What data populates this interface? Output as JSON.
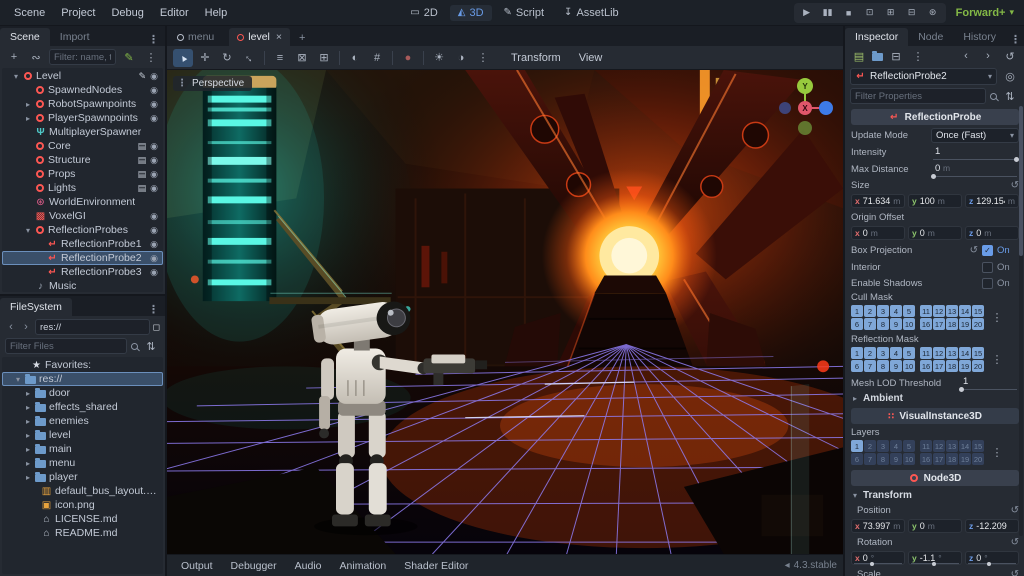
{
  "icons": {
    "play": "▶",
    "pause": "▮▮",
    "stop": "■",
    "remote_debug": "⊡",
    "play_scene": "⊞",
    "play_custom_scene": "⊟",
    "movie_maker": "⊛",
    "dropdown": "▾",
    "chevron_right": "▸",
    "close": "×",
    "add": "+",
    "instance": "∾",
    "panel_menu": "⋮",
    "script_green": "✎",
    "back": "‹",
    "forward": "›",
    "history": "↺",
    "revert": "↺",
    "check": "✓",
    "split_mode": "◻",
    "sort": "⇅",
    "new_resource": "▤",
    "save": "⊟",
    "tool": "◎",
    "dots": "⋮",
    "version": "◂"
  },
  "menubar": {
    "items": [
      "Scene",
      "Project",
      "Debug",
      "Editor",
      "Help"
    ],
    "modes": [
      {
        "label": "2D",
        "glyph": "▭",
        "cls": "mode"
      },
      {
        "label": "3D",
        "glyph": "◭",
        "cls": "mode active"
      },
      {
        "label": "Script",
        "glyph": "✎",
        "cls": "mode"
      },
      {
        "label": "AssetLib",
        "glyph": "↧",
        "cls": "mode"
      }
    ],
    "playback": [
      {
        "glyph": "▶",
        "name": "play-button"
      },
      {
        "glyph": "▮▮",
        "name": "pause-button"
      },
      {
        "glyph": "■",
        "name": "stop-button"
      },
      {
        "glyph": "⊡",
        "name": "remote-debug-button"
      },
      {
        "glyph": "⊞",
        "name": "play-scene-button"
      },
      {
        "glyph": "⊟",
        "name": "play-custom-scene-button"
      },
      {
        "glyph": "⊛",
        "name": "movie-maker-button"
      }
    ],
    "renderer": "Forward+"
  },
  "scene_dock": {
    "tabs": [
      {
        "label": "Scene",
        "cls": "ptab active"
      },
      {
        "label": "Import",
        "cls": "ptab"
      }
    ],
    "filter_placeholder": "Filter: name, t:type, g",
    "tree": [
      {
        "cls": "trow",
        "pad": 2,
        "chev": "▾",
        "icon_cls": "ic ic-ring",
        "label": "Level",
        "b1": "✎",
        "b2": "◉"
      },
      {
        "cls": "trow",
        "pad": 14,
        "chev": "",
        "icon_cls": "ic ic-ring",
        "label": "SpawnedNodes",
        "b1": "",
        "b2": "◉"
      },
      {
        "cls": "trow",
        "pad": 14,
        "chev": "▸",
        "icon_cls": "ic ic-ring",
        "label": "RobotSpawnpoints",
        "b1": "",
        "b2": "◉"
      },
      {
        "cls": "trow",
        "pad": 14,
        "chev": "▸",
        "icon_cls": "ic ic-ring",
        "label": "PlayerSpawnpoints",
        "b1": "",
        "b2": "◉"
      },
      {
        "cls": "trow",
        "pad": 14,
        "chev": "",
        "icon_cls": "ic ic-antenna",
        "glyph": "Ψ",
        "label": "MultiplayerSpawner",
        "b1": "",
        "b2": ""
      },
      {
        "cls": "trow",
        "pad": 14,
        "chev": "",
        "icon_cls": "ic ic-ring",
        "label": "Core",
        "b1": "▤",
        "b2": "◉"
      },
      {
        "cls": "trow",
        "pad": 14,
        "chev": "",
        "icon_cls": "ic ic-ring",
        "label": "Structure",
        "b1": "▤",
        "b2": "◉"
      },
      {
        "cls": "trow",
        "pad": 14,
        "chev": "",
        "icon_cls": "ic ic-ring",
        "label": "Props",
        "b1": "▤",
        "b2": "◉"
      },
      {
        "cls": "trow",
        "pad": 14,
        "chev": "",
        "icon_cls": "ic ic-ring",
        "label": "Lights",
        "b1": "▤",
        "b2": "◉"
      },
      {
        "cls": "trow",
        "pad": 14,
        "chev": "",
        "icon_cls": "ic ic-worldenv",
        "label": "WorldEnvironment",
        "b1": "",
        "b2": ""
      },
      {
        "cls": "trow",
        "pad": 14,
        "chev": "",
        "icon_cls": "ic ic-voxel",
        "label": "VoxelGI",
        "b1": "",
        "b2": "◉"
      },
      {
        "cls": "trow",
        "pad": 14,
        "chev": "▾",
        "icon_cls": "ic ic-ring",
        "label": "ReflectionProbes",
        "b1": "",
        "b2": "◉"
      },
      {
        "cls": "trow",
        "pad": 26,
        "chev": "",
        "icon_cls": "ic ic-probe",
        "label": "ReflectionProbe1",
        "b1": "",
        "b2": "◉"
      },
      {
        "cls": "trow selected",
        "pad": 26,
        "chev": "",
        "icon_cls": "ic ic-probe",
        "label": "ReflectionProbe2",
        "b1": "",
        "b2": "◉"
      },
      {
        "cls": "trow",
        "pad": 26,
        "chev": "",
        "icon_cls": "ic ic-probe",
        "label": "ReflectionProbe3",
        "b1": "",
        "b2": "◉"
      },
      {
        "cls": "trow",
        "pad": 14,
        "chev": "",
        "icon_cls": "ic ic-music",
        "label": "Music",
        "b1": "",
        "b2": ""
      }
    ]
  },
  "filesystem_dock": {
    "tab": "FileSystem",
    "path": "res://",
    "filter_placeholder": "Filter Files",
    "tree": [
      {
        "cls": "trow",
        "pad": 10,
        "chev": "",
        "icon_cls": "ic ic-star",
        "label": "Favorites:"
      },
      {
        "cls": "trow selected",
        "pad": 4,
        "chev": "▾",
        "icon_cls": "ic ic-folder",
        "label": "res://"
      },
      {
        "cls": "trow",
        "pad": 14,
        "chev": "▸",
        "icon_cls": "ic ic-folder",
        "label": "door"
      },
      {
        "cls": "trow",
        "pad": 14,
        "chev": "▸",
        "icon_cls": "ic ic-folder",
        "label": "effects_shared"
      },
      {
        "cls": "trow",
        "pad": 14,
        "chev": "▸",
        "icon_cls": "ic ic-folder",
        "label": "enemies"
      },
      {
        "cls": "trow",
        "pad": 14,
        "chev": "▸",
        "icon_cls": "ic ic-folder",
        "label": "level"
      },
      {
        "cls": "trow",
        "pad": 14,
        "chev": "▸",
        "icon_cls": "ic ic-folder",
        "label": "main"
      },
      {
        "cls": "trow",
        "pad": 14,
        "chev": "▸",
        "icon_cls": "ic ic-folder",
        "label": "menu"
      },
      {
        "cls": "trow",
        "pad": 14,
        "chev": "▸",
        "icon_cls": "ic ic-folder",
        "label": "player"
      },
      {
        "cls": "trow",
        "pad": 20,
        "chev": "",
        "icon_cls": "ic ic-audio",
        "label": "default_bus_layout.tres"
      },
      {
        "cls": "trow",
        "pad": 20,
        "chev": "",
        "icon_cls": "ic ic-image",
        "label": "icon.png"
      },
      {
        "cls": "trow",
        "pad": 20,
        "chev": "",
        "icon_cls": "ic ic-home",
        "label": "LICENSE.md"
      },
      {
        "cls": "trow",
        "pad": 20,
        "chev": "",
        "icon_cls": "ic ic-home",
        "label": "README.md"
      }
    ]
  },
  "viewport": {
    "tabs": [
      {
        "label": "menu",
        "cls": "stab",
        "icolor": "#b9c0cc",
        "close": ""
      },
      {
        "label": "level",
        "cls": "stab active",
        "icolor": "#fc5753",
        "close": "×"
      }
    ],
    "perspective_label": "Perspective",
    "menus": [
      {
        "label": "Transform"
      },
      {
        "label": "View"
      }
    ],
    "gizmo": {
      "y": "Y",
      "x": "X"
    }
  },
  "toolbar3d": {
    "buttons": [
      {
        "cls": "tbtn active",
        "glyph": "▲",
        "gcls": "rotNW",
        "name": "select-tool-button",
        "style": ""
      },
      {
        "cls": "tbtn",
        "glyph": "✛",
        "gcls": "",
        "name": "move-tool-button",
        "style": ""
      },
      {
        "cls": "tbtn",
        "glyph": "↻",
        "gcls": "",
        "name": "rotate-tool-button",
        "style": ""
      },
      {
        "cls": "tbtn",
        "glyph": "↔",
        "gcls": "rot45",
        "name": "scale-tool-button",
        "style": ""
      },
      {
        "cls": "tsep",
        "glyph": "",
        "gcls": "",
        "name": "separator",
        "style": ""
      },
      {
        "cls": "tbtn",
        "glyph": "≡",
        "gcls": "",
        "name": "select-list-button",
        "style": ""
      },
      {
        "cls": "tbtn",
        "glyph": "⊠",
        "gcls": "",
        "name": "lock-button",
        "style": ""
      },
      {
        "cls": "tbtn",
        "glyph": "⊞",
        "gcls": "",
        "name": "group-button",
        "style": ""
      },
      {
        "cls": "tsep",
        "glyph": "",
        "gcls": "",
        "name": "separator",
        "style": ""
      },
      {
        "cls": "tbtn",
        "glyph": "◐",
        "gcls": "",
        "name": "local-space-button",
        "style": ""
      },
      {
        "cls": "tbtn",
        "glyph": "#",
        "gcls": "",
        "name": "snap-button",
        "style": ""
      },
      {
        "cls": "tsep",
        "glyph": "",
        "gcls": "",
        "name": "separator",
        "style": ""
      },
      {
        "cls": "tbtn",
        "glyph": "●",
        "gcls": "",
        "name": "camera-preview-button",
        "style": "color:#a85a5a"
      },
      {
        "cls": "tsep",
        "glyph": "",
        "gcls": "",
        "name": "separator",
        "style": ""
      },
      {
        "cls": "tbtn",
        "glyph": "☀",
        "gcls": "",
        "name": "preview-sun-button",
        "style": ""
      },
      {
        "cls": "tbtn",
        "glyph": "◑",
        "gcls": "",
        "name": "preview-environment-button",
        "style": ""
      },
      {
        "cls": "tbtn",
        "glyph": "⋮",
        "gcls": "",
        "name": "view-extras-menu",
        "style": ""
      }
    ]
  },
  "inspector": {
    "tabs": [
      {
        "label": "Inspector",
        "cls": "ptab active"
      },
      {
        "label": "Node",
        "cls": "ptab"
      },
      {
        "label": "History",
        "cls": "ptab"
      }
    ],
    "node_name": "ReflectionProbe2",
    "filter_placeholder": "Filter Properties",
    "mask_rows": [
      {
        "a": [
          1,
          2,
          3,
          4,
          5
        ],
        "b": [
          11,
          12,
          13,
          14,
          15
        ]
      },
      {
        "a": [
          6,
          7,
          8,
          9,
          10
        ],
        "b": [
          16,
          17,
          18,
          19,
          20
        ]
      }
    ],
    "cull_mask_active": "all",
    "reflection_mask_active": "all",
    "layers_active": [
      1
    ],
    "rp": {
      "header": "ReflectionProbe",
      "update_mode": {
        "label": "Update Mode",
        "value": "Once (Fast)"
      },
      "intensity": {
        "label": "Intensity",
        "value": "1"
      },
      "max_distance": {
        "label": "Max Distance",
        "value": "0",
        "unit": "m"
      },
      "size": {
        "label": "Size",
        "x": "71.634",
        "xu": "m",
        "y": "100",
        "yu": "m",
        "z": "129.154",
        "zu": "m"
      },
      "origin_offset": {
        "label": "Origin Offset",
        "x": "0",
        "xu": "m",
        "y": "0",
        "yu": "m",
        "z": "0",
        "zu": "m"
      },
      "box_projection": {
        "label": "Box Projection",
        "value": "On"
      },
      "interior": {
        "label": "Interior",
        "value": "On"
      },
      "enable_shadows": {
        "label": "Enable Shadows",
        "value": "On"
      },
      "cull_mask": {
        "label": "Cull Mask"
      },
      "reflection_mask": {
        "label": "Reflection Mask"
      },
      "mesh_lod_threshold": {
        "label": "Mesh LOD Threshold",
        "value": "1"
      },
      "ambient": {
        "label": "Ambient"
      }
    },
    "vi": {
      "header": "VisualInstance3D",
      "layers_label": "Layers"
    },
    "n3d": {
      "header": "Node3D",
      "transform_label": "Transform",
      "position": {
        "label": "Position",
        "x": "73.997",
        "xu": "m",
        "y": "0",
        "yu": "m",
        "z": "-12.209",
        "zu": ""
      },
      "rotation": {
        "label": "Rotation",
        "x": "0",
        "xu": "°",
        "y": "-1.1",
        "yu": "°",
        "z": "0",
        "zu": "°"
      },
      "scale_label": "Scale"
    }
  },
  "bottom_bar": {
    "tabs": [
      "Output",
      "Debugger",
      "Audio",
      "Animation",
      "Shader Editor"
    ],
    "version": "4.3.stable"
  }
}
